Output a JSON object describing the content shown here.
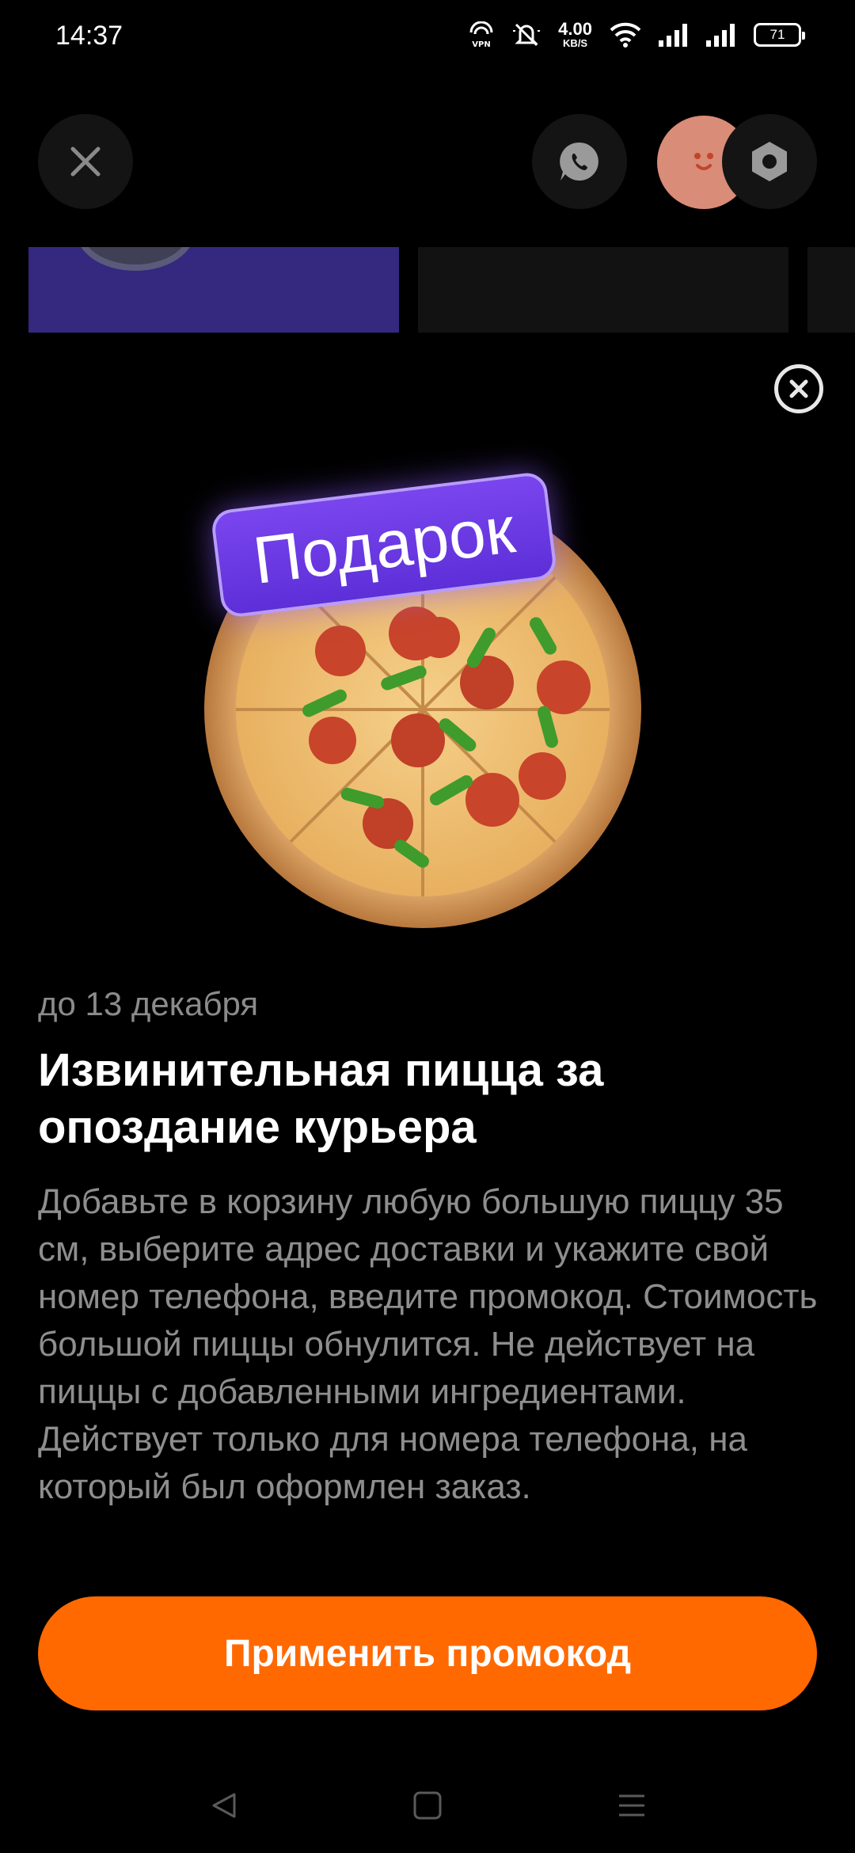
{
  "status_bar": {
    "time": "14:37",
    "vpn_label": "VPN",
    "net_speed_value": "4.00",
    "net_speed_unit": "KB/S",
    "battery": "71"
  },
  "header": {
    "icons": {
      "close": "close-icon",
      "chat": "whatsapp-icon",
      "avatar": "avatar",
      "settings": "settings-icon"
    }
  },
  "promo": {
    "badge": "Подарок",
    "deadline": "до 13 декабря",
    "title": "Извинительная пицца за опоздание курьера",
    "description": "Добавьте в корзину любую большую пиццу 35 см, выберите адрес доставки и укажите свой номер телефона, введите промокод. Стоимость большой пиццы обнулится. Не действует на пиццы с добавленными ингредиентами. Действует только для номера телефона, на который был оформлен заказ.",
    "button_label": "Применить промокод"
  },
  "colors": {
    "accent": "#ff6900",
    "badge": "#6a38e4",
    "background": "#000000",
    "muted_text": "#8e8e8e"
  }
}
